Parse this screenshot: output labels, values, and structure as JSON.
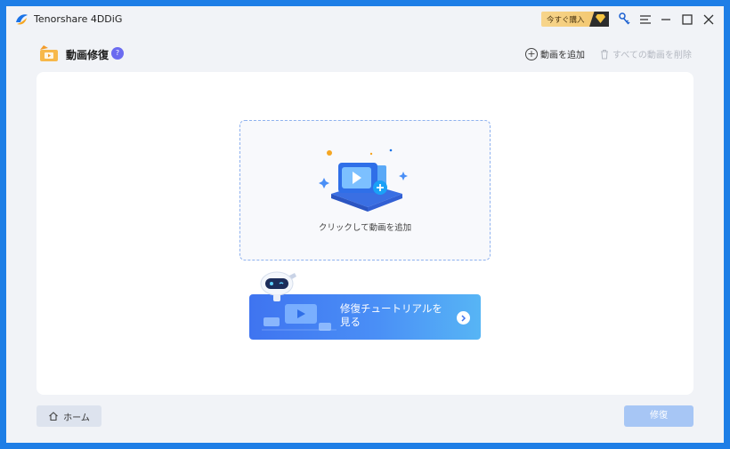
{
  "app": {
    "title": "Tenorshare 4DDiG",
    "buy_label": "今すぐ購入"
  },
  "header": {
    "title": "動画修復",
    "help": "?",
    "add_video_label": "動画を追加",
    "delete_all_label": "すべての動画を削除"
  },
  "dropzone": {
    "hint": "クリックして動画を追加"
  },
  "tutorial": {
    "label": "修復チュートリアルを見る"
  },
  "footer": {
    "home_label": "ホーム",
    "repair_label": "修復"
  },
  "colors": {
    "frame": "#1e7ee6",
    "background": "#f1f3f7",
    "accent": "#3f74f0",
    "repair_disabled": "#a7c6f5",
    "help_badge": "#6b6bf0",
    "buy_badge": "#f2c56b"
  }
}
